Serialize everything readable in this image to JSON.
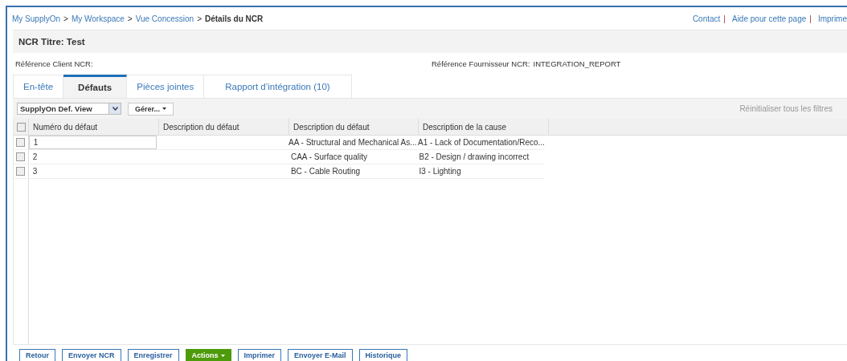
{
  "breadcrumb": {
    "links": [
      "My SupplyOn",
      "My Workspace",
      "Vue Concession"
    ],
    "current": "Détails du NCR",
    "separator": ">"
  },
  "top_links": [
    "Contact",
    "Aide pour cette page",
    "Imprime"
  ],
  "top_link_divider": "|",
  "title": "NCR Titre: Test",
  "references": {
    "client_label": "Référence Client NCR:",
    "supplier_label": "Référence Fournisseur NCR:",
    "supplier_value": "INTEGRATION_REPORT"
  },
  "tabs": [
    {
      "label": "En-tête",
      "selected": false
    },
    {
      "label": "Défauts",
      "selected": true
    },
    {
      "label": "Pièces jointes",
      "selected": false
    },
    {
      "label": "Rapport d’intégration (10)",
      "selected": false
    }
  ],
  "toolbar": {
    "view": "SupplyOn Def. View",
    "manage": "Gérer...",
    "reset": "Réinitialiser tous les filtres"
  },
  "table": {
    "select_all_checked": false,
    "columns": [
      "Numéro du défaut",
      "Description du défaut",
      "Description du défaut",
      "Description de la cause"
    ],
    "rows": [
      {
        "checked": false,
        "cells": [
          "1",
          "",
          "AA - Structural and Mechanical As...",
          "A1 - Lack of Documentation/Reco..."
        ]
      },
      {
        "checked": false,
        "cells": [
          "2",
          "",
          "CAA - Surface quality",
          "B2 - Design / drawing incorrect"
        ]
      },
      {
        "checked": false,
        "cells": [
          "3",
          "",
          "BC - Cable Routing",
          "I3 - Lighting"
        ]
      }
    ]
  },
  "buttons": [
    {
      "label": "Retour",
      "kind": "normal"
    },
    {
      "label": "Envoyer NCR",
      "kind": "normal"
    },
    {
      "label": "Enregistrer",
      "kind": "normal"
    },
    {
      "label": "Actions",
      "kind": "menu"
    },
    {
      "label": "Imprimer",
      "kind": "normal"
    },
    {
      "label": "Envoyer E-Mail",
      "kind": "normal"
    },
    {
      "label": "Historique",
      "kind": "normal"
    }
  ]
}
